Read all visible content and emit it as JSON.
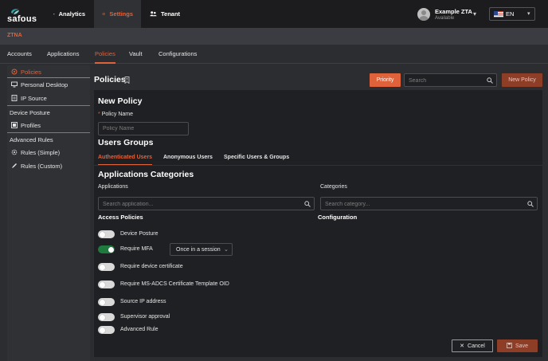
{
  "app": {
    "logo_text": "safous"
  },
  "topnav": {
    "analytics": "Analytics",
    "settings": "Settings",
    "tenant": "Tenant"
  },
  "user": {
    "name": "Example ZTA",
    "status": "Available"
  },
  "language": {
    "code": "EN"
  },
  "section": {
    "title": "ZTNA"
  },
  "subtabs": [
    "Accounts",
    "Applications",
    "Policies",
    "Vault",
    "Configurations"
  ],
  "sidebar": {
    "policies": "Policies",
    "personal_desktop": "Personal Desktop",
    "ip_source": "IP Source",
    "device_posture": "Device Posture",
    "profiles": "Profiles",
    "advanced_rules": "Advanced Rules",
    "rules_simple": "Rules (Simple)",
    "rules_custom": "Rules (Custom)"
  },
  "main": {
    "title": "Policies",
    "priority_label": "Priority",
    "search_placeholder": "Search",
    "new_policy_label": "New Policy"
  },
  "form": {
    "heading": "New Policy",
    "policy_name_label": "Policy Name",
    "policy_name_placeholder": "Policy Name",
    "user_groups_heading": "Users Groups",
    "user_tabs": [
      "Authenticated Users",
      "Anonymous Users",
      "Specific Users & Groups"
    ],
    "app_categories_heading": "Applications Categories",
    "applications_label": "Applications",
    "categories_label": "Categories",
    "search_application_placeholder": "Search application...",
    "search_category_placeholder": "Search category...",
    "access_policies_heading": "Access Policies",
    "configuration_heading": "Configuration",
    "toggles": [
      {
        "label": "Device Posture",
        "on": false
      },
      {
        "label": "Require MFA",
        "on": true
      },
      {
        "label": "Require device certificate",
        "on": false
      },
      {
        "label": "Require MS-ADCS Certificate Template OID",
        "on": false
      },
      {
        "label": "Source IP address",
        "on": false
      },
      {
        "label": "Supervisor approval",
        "on": false
      },
      {
        "label": "Advanced Rule",
        "on": false
      }
    ],
    "mfa_option": "Once in a session",
    "cancel_label": "Cancel",
    "save_label": "Save"
  },
  "colors": {
    "accent": "#e0623a",
    "accent_dark": "#8e3d27",
    "toggle_on": "#1f7a3e",
    "logo_mark": "#2ea3a3"
  },
  "icons": [
    "safous-logo-icon",
    "analytics-icon",
    "gear-icon",
    "tenant-icon",
    "chevron-down-icon",
    "flag-us-icon",
    "policies-icon",
    "desktop-icon",
    "ip-source-icon",
    "profiles-icon",
    "rules-simple-icon",
    "rules-custom-icon",
    "bookmark-icon",
    "search-icon",
    "close-icon",
    "save-icon"
  ]
}
